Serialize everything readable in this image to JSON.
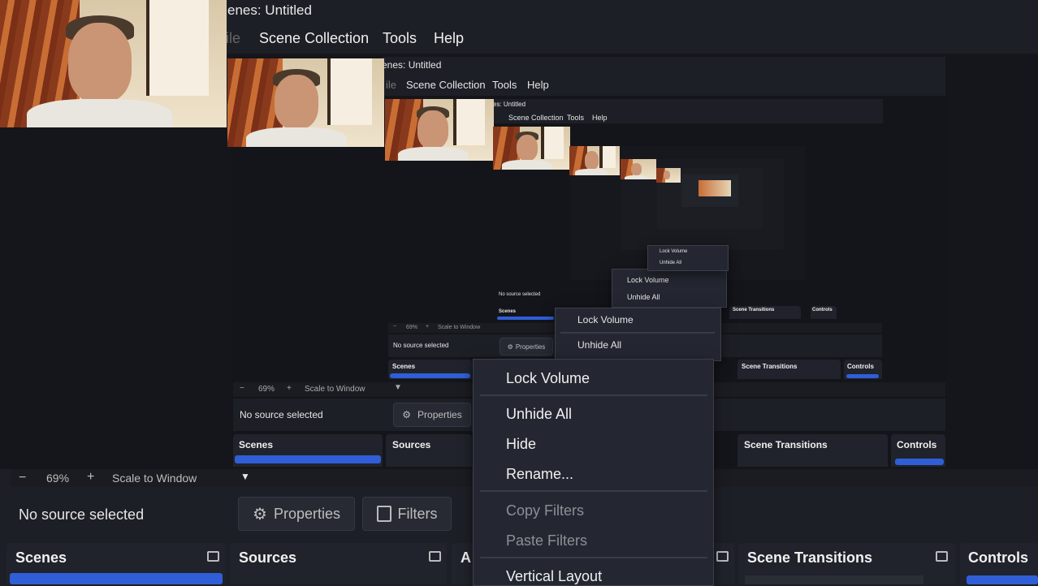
{
  "window": {
    "title": "Scenes: Untitled"
  },
  "menu": {
    "file": "File",
    "scene_collection": "Scene Collection",
    "tools": "Tools",
    "help": "Help"
  },
  "preview": {
    "zoom_minus": "−",
    "zoom": "69%",
    "zoom_plus": "+",
    "scale_mode": "Scale to Window"
  },
  "source_bar": {
    "status": "No source selected",
    "properties": "Properties",
    "filters": "Filters"
  },
  "docks": {
    "scenes": "Scenes",
    "sources": "Sources",
    "audio": "A",
    "scene_transitions": "Scene Transitions",
    "controls": "Controls"
  },
  "context_menu": {
    "lock_volume": "Lock Volume",
    "unhide_all": "Unhide All",
    "hide": "Hide",
    "rename": "Rename...",
    "copy_filters": "Copy Filters",
    "paste_filters": "Paste Filters",
    "vertical_layout": "Vertical Layout"
  },
  "nested": {
    "title_1": "enes: Untitled",
    "title_2": "enes: Untitled",
    "title_3": "es: Untitled",
    "file_fragment": "ile"
  },
  "colors": {
    "accent": "#2f5ed7",
    "background": "#1d1f26",
    "panel": "#20232b"
  }
}
